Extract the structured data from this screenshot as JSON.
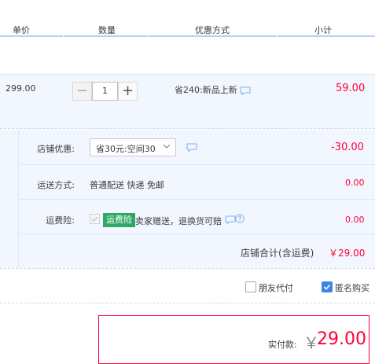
{
  "header": {
    "col_price": "单价",
    "col_qty": "数量",
    "col_discount": "优惠方式",
    "col_subtotal": "小计"
  },
  "item": {
    "price": "299.00",
    "quantity": "1",
    "minus_symbol": "−",
    "plus_symbol": "+",
    "discount": "省240:新品上新",
    "subtotal": "59.00"
  },
  "shop": {
    "discount_label": "店铺优惠:",
    "discount_value": "省30元:空间30",
    "discount_amount": "-30.00",
    "shipping_label": "运送方式:",
    "shipping_value": "普通配送 快递 免邮",
    "shipping_amount": "0.00",
    "insurance_label": "运费险:",
    "insurance_badge": "运费险",
    "insurance_desc": "卖家赠送，退换货可赔",
    "insurance_amount": "0.00",
    "total_label": "店铺合计(含运费)",
    "total_amount": "￥29.00"
  },
  "options": {
    "friend_pay": "朋友代付",
    "anonymous": "匿名购买"
  },
  "payment": {
    "label": "实付款:",
    "currency": "￥",
    "amount": "29.00"
  },
  "colors": {
    "accent_red": "#ff0036",
    "light_blue_bg": "#f2f7ff",
    "checkbox_blue": "#3d86e8",
    "badge_green": "#2fa863"
  },
  "icons": {
    "message": "message-icon",
    "question": "question-icon",
    "chevron": "chevron-down-icon"
  }
}
